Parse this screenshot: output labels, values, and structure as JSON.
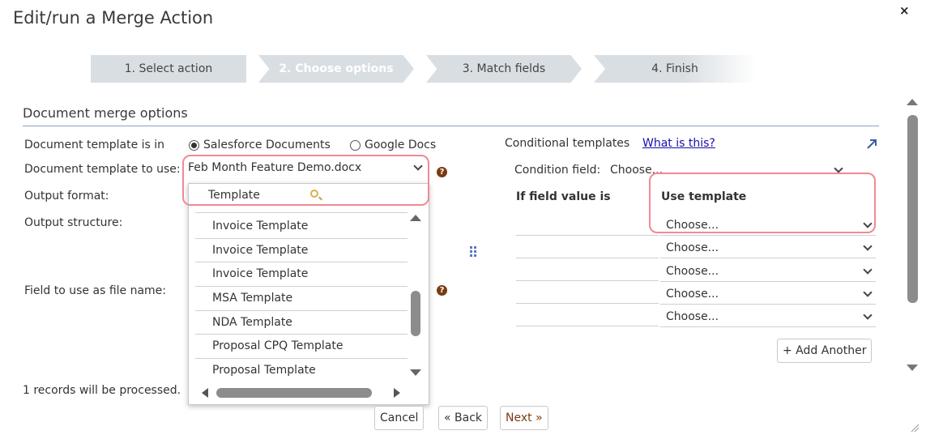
{
  "dialog": {
    "title": "Edit/run a Merge Action",
    "close_glyph": "×"
  },
  "steps": [
    "1. Select action",
    "2. Choose options",
    "3. Match fields",
    "4. Finish"
  ],
  "section": {
    "title": "Document merge options"
  },
  "left_form": {
    "template_in_label": "Document template is in",
    "radio_salesforce": "Salesforce Documents",
    "radio_google": "Google Docs",
    "template_to_use_label": "Document template to use:",
    "template_selected": "Feb Month Feature Demo.docx",
    "output_format_label": "Output format:",
    "output_structure_label": "Output structure:",
    "file_name_label": "Field to use as file name:",
    "records_note": "1 records will be processed."
  },
  "dropdown": {
    "search_value": "Template",
    "items": [
      "Invoice Template",
      "Invoice Template",
      "Invoice Template",
      "MSA Template",
      "NDA Template",
      "Proposal CPQ Template",
      "Proposal Template"
    ]
  },
  "conditional": {
    "label": "Conditional templates",
    "link": "What is this?",
    "condition_field_label": "Condition field:",
    "condition_field_value": "Choose...",
    "col_if_value": "If field value is",
    "col_use_template": "Use template",
    "rows": [
      "Choose...",
      "Choose...",
      "Choose...",
      "Choose...",
      "Choose..."
    ],
    "add_another": "+ Add Another"
  },
  "footer": {
    "cancel": "Cancel",
    "back": "« Back",
    "next": "Next »"
  },
  "colors": {
    "annotation": "#f08a93",
    "help_icon": "#7a3b13",
    "link": "#1a0dab"
  }
}
